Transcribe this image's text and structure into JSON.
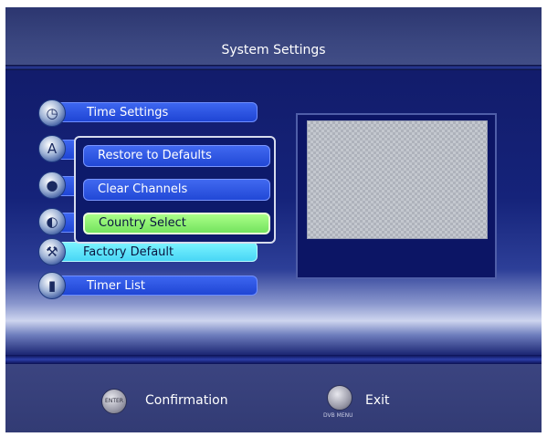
{
  "header": {
    "title": "System Settings"
  },
  "menu": {
    "items": [
      {
        "label": "Time Settings",
        "icon": "clock-icon"
      },
      {
        "label": "",
        "icon": "language-icon"
      },
      {
        "label": "",
        "icon": "parental-icon"
      },
      {
        "label": "",
        "icon": "globe-icon"
      },
      {
        "label": "Factory Default",
        "icon": "tools-icon"
      },
      {
        "label": "Timer List",
        "icon": "timer-icon"
      }
    ],
    "active_index": 4
  },
  "popup": {
    "options": [
      "Restore to Defaults",
      "Clear Channels",
      "Country Select"
    ],
    "selected_index": 2
  },
  "footer": {
    "confirm_button_text": "ENTER",
    "confirm_label": "Confirmation",
    "exit_button_sub": "DVB MENU",
    "exit_label": "Exit"
  },
  "colors": {
    "menu_item": "#2b52e0",
    "active_item": "#5fe3f8",
    "selected_option": "#8ef06f",
    "background": "#15205e"
  }
}
